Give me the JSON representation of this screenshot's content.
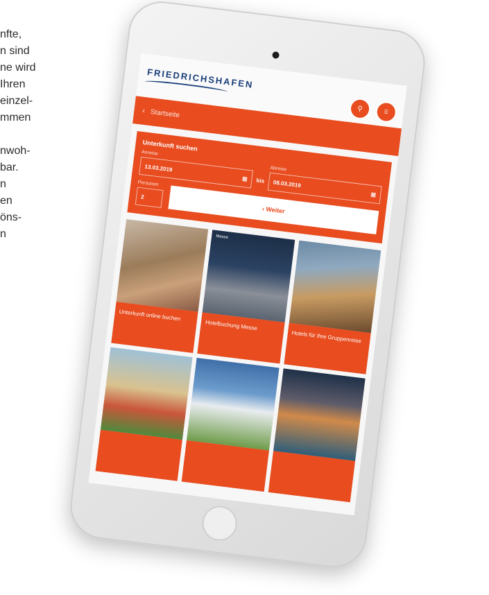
{
  "side_text": {
    "para1": [
      "nfte,",
      "n sind",
      "ne wird",
      "Ihren",
      "einzel-",
      "mmen"
    ],
    "para2": [
      "nwoh-",
      "bar.",
      "n",
      "en",
      "öns-",
      "n"
    ]
  },
  "tablet": {
    "logo": "FRIEDRICHSHAFEN",
    "nav": {
      "back_label": "Startseite"
    },
    "booking": {
      "title": "Unterkunft suchen",
      "arrival_label": "Anreise",
      "arrival_value": "13.03.2019",
      "until_label": "bis",
      "departure_label": "Abreise",
      "departure_value": "08.03.2019",
      "persons_label": "Personen",
      "persons_value": "2",
      "submit_label": "Weiter"
    },
    "tiles": [
      {
        "tag": "",
        "caption": "Unterkunft online buchen"
      },
      {
        "tag": "Messe",
        "caption": "Hotelbuchung Messe"
      },
      {
        "tag": "",
        "caption": "Hotels für Ihre Gruppenreise"
      },
      {
        "tag": "",
        "caption": ""
      },
      {
        "tag": "",
        "caption": ""
      },
      {
        "tag": "",
        "caption": ""
      }
    ]
  },
  "colors": {
    "accent": "#e84c1f",
    "logo": "#1b3f7a"
  }
}
